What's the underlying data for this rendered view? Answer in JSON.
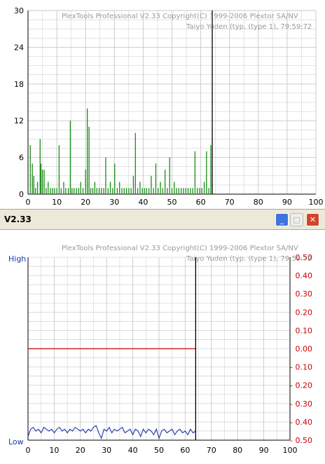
{
  "window": {
    "title": "V2.33",
    "min_glyph": "_",
    "max_glyph": "□",
    "close_glyph": "✕"
  },
  "watermark": {
    "line1": "PlexTools Professional  V2.33 Copyright(C) 1999-2006 Plextor SA/NV",
    "line2": "Taiyo Yuden (typ. (type 1), 79:59:72"
  },
  "colors": {
    "error_bar": "#1a8c1a",
    "jitter_line": "#2233aa",
    "beta_line": "#cc2222",
    "right_axis": "#cc0000",
    "left_axis_label": "#1a3aa8",
    "grid": "#c8c8c8",
    "cursor": "#000000"
  },
  "chart_data": [
    {
      "type": "bar",
      "name": "c1-errors",
      "x_ticks": [
        "0",
        "10",
        "20",
        "30",
        "40",
        "50",
        "60",
        "70",
        "80",
        "90",
        "100"
      ],
      "y_ticks": [
        "30",
        "24",
        "18",
        "12",
        "6",
        "0"
      ],
      "xlim": [
        0,
        100
      ],
      "ylim": [
        0,
        30
      ],
      "cursor_x": 64,
      "x": [
        0.8,
        1.5,
        2.0,
        2.6,
        3.3,
        4.2,
        4.5,
        5.0,
        5.6,
        6.3,
        7.0,
        7.8,
        8.5,
        9.2,
        10.0,
        10.8,
        11.5,
        12.4,
        13.1,
        14.0,
        14.7,
        15.3,
        16.0,
        16.8,
        17.6,
        18.3,
        19.1,
        20.0,
        20.6,
        21.2,
        21.8,
        22.5,
        23.2,
        23.9,
        24.7,
        25.5,
        26.3,
        27.0,
        27.8,
        28.6,
        29.4,
        30.1,
        31.0,
        31.8,
        32.6,
        33.4,
        34.2,
        35.0,
        35.8,
        36.6,
        37.3,
        38.1,
        38.9,
        39.7,
        40.5,
        41.2,
        42.0,
        42.8,
        43.6,
        44.4,
        45.2,
        46.0,
        46.8,
        47.6,
        48.4,
        49.2,
        50.0,
        50.8,
        51.6,
        52.4,
        53.2,
        54.0,
        54.8,
        55.6,
        56.4,
        57.2,
        58.0,
        58.8,
        59.6,
        60.4,
        61.2,
        62.0,
        62.8,
        63.5
      ],
      "values": [
        8,
        5,
        3,
        1,
        2,
        9,
        5,
        4,
        4,
        1,
        2,
        1,
        1,
        1,
        1,
        8,
        1,
        2,
        1,
        1,
        12,
        1,
        1,
        1,
        1,
        2,
        1,
        4,
        14,
        11,
        1,
        1,
        2,
        1,
        1,
        1,
        1,
        6,
        1,
        2,
        1,
        5,
        1,
        2,
        1,
        1,
        1,
        1,
        1,
        3,
        10,
        1,
        2,
        1,
        1,
        1,
        1,
        3,
        1,
        5,
        1,
        2,
        1,
        4,
        1,
        6,
        1,
        2,
        1,
        1,
        1,
        1,
        1,
        1,
        1,
        1,
        7,
        1,
        1,
        1,
        2,
        7,
        1,
        8
      ]
    },
    {
      "type": "line",
      "name": "jitter-beta",
      "x_ticks": [
        "0",
        "10",
        "20",
        "30",
        "40",
        "50",
        "60",
        "70",
        "80",
        "90",
        "100"
      ],
      "left_labels": [
        "High",
        "Low"
      ],
      "right_ticks": [
        "0.50",
        "0.40",
        "0.30",
        "0.20",
        "0.10",
        "0.00",
        "- 0.10",
        "- 0.20",
        "- 0.30",
        "- 0.40",
        "- 0.50"
      ],
      "xlim": [
        0,
        100
      ],
      "ylim_right": [
        -0.5,
        0.5
      ],
      "cursor_x": 64,
      "series": [
        {
          "name": "beta",
          "x": [
            0,
            64
          ],
          "values": [
            0.0,
            0.0
          ]
        },
        {
          "name": "jitter",
          "x": [
            0,
            1,
            2,
            3,
            4,
            5,
            6,
            7,
            8,
            9,
            10,
            11,
            12,
            13,
            14,
            15,
            16,
            17,
            18,
            19,
            20,
            21,
            22,
            23,
            24,
            25,
            26,
            27,
            28,
            29,
            30,
            31,
            32,
            33,
            34,
            35,
            36,
            37,
            38,
            39,
            40,
            41,
            42,
            43,
            44,
            45,
            46,
            47,
            48,
            49,
            50,
            51,
            52,
            53,
            54,
            55,
            56,
            57,
            58,
            59,
            60,
            61,
            62,
            63,
            64
          ],
          "values": [
            -0.48,
            -0.44,
            -0.43,
            -0.45,
            -0.44,
            -0.46,
            -0.43,
            -0.44,
            -0.45,
            -0.44,
            -0.46,
            -0.44,
            -0.43,
            -0.45,
            -0.44,
            -0.46,
            -0.44,
            -0.45,
            -0.43,
            -0.44,
            -0.45,
            -0.44,
            -0.46,
            -0.44,
            -0.45,
            -0.43,
            -0.42,
            -0.46,
            -0.49,
            -0.44,
            -0.45,
            -0.43,
            -0.46,
            -0.44,
            -0.45,
            -0.44,
            -0.43,
            -0.46,
            -0.45,
            -0.44,
            -0.47,
            -0.44,
            -0.45,
            -0.48,
            -0.44,
            -0.46,
            -0.44,
            -0.45,
            -0.47,
            -0.44,
            -0.49,
            -0.45,
            -0.44,
            -0.46,
            -0.45,
            -0.44,
            -0.47,
            -0.45,
            -0.44,
            -0.46,
            -0.45,
            -0.47,
            -0.44,
            -0.46,
            -0.45
          ]
        }
      ]
    }
  ]
}
